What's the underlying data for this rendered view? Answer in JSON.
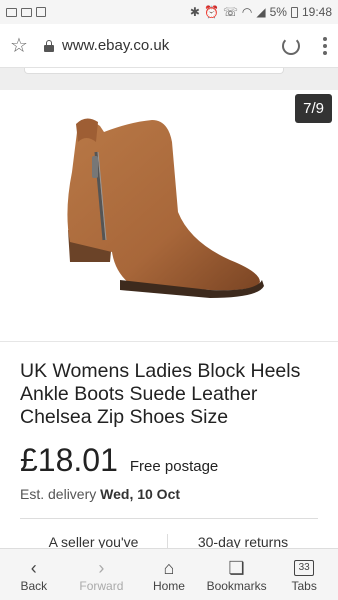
{
  "status_bar": {
    "battery": "5%",
    "time": "19:48"
  },
  "browser": {
    "url": "www.ebay.co.uk"
  },
  "gallery": {
    "counter": "7/9"
  },
  "listing": {
    "title": "UK Womens Ladies Block Heels Ankle Boots Suede Leather Chelsea Zip Shoes Size",
    "price": "£18.01",
    "postage": "Free postage",
    "delivery_prefix": "Est. delivery",
    "delivery_date": "Wed, 10 Oct",
    "seller_note": "A seller you've",
    "returns": "30-day returns"
  },
  "bottom_nav": {
    "back": "Back",
    "forward": "Forward",
    "home": "Home",
    "bookmarks": "Bookmarks",
    "tabs": "Tabs",
    "tabs_count": "33"
  },
  "icons": {
    "status_left": [
      "mail-icon",
      "email-icon",
      "checkbox-icon"
    ],
    "status_right": [
      "bluetooth-icon",
      "alarm-icon",
      "phone-icon",
      "wifi-icon",
      "signal-icon",
      "battery-icon"
    ],
    "address": [
      "star-icon",
      "lock-icon",
      "reload-icon",
      "menu-icon"
    ],
    "nav": [
      "back-icon",
      "forward-icon",
      "home-icon",
      "bookmarks-icon",
      "tabs-icon"
    ]
  },
  "colors": {
    "boot": "#a8673a",
    "counter_bg": "#333333"
  }
}
